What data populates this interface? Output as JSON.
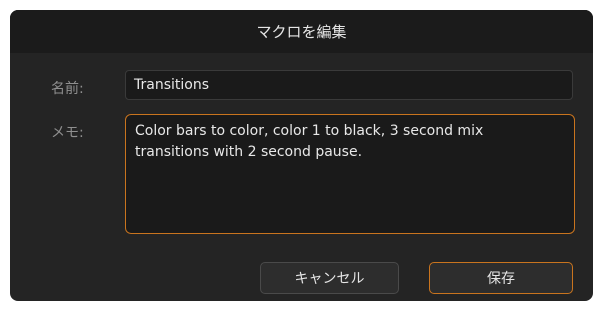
{
  "dialog": {
    "title": "マクロを編集",
    "name_label": "名前:",
    "name_value": "Transitions",
    "memo_label": "メモ:",
    "memo_value": "Color bars to color, color 1 to black, 3 second mix\ntransitions with 2 second pause.",
    "cancel_label": "キャンセル",
    "save_label": "保存"
  },
  "colors": {
    "background": "#242424",
    "titlebar": "#1b1b1b",
    "accent": "#c9741e"
  }
}
